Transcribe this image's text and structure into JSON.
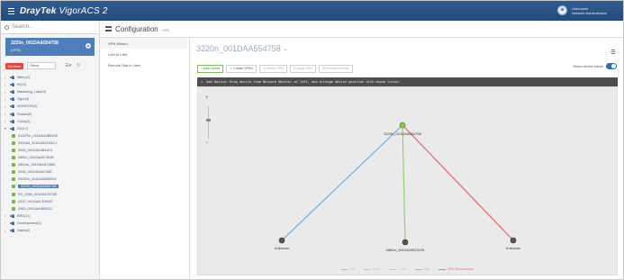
{
  "app": {
    "brand_name": "DrayTek",
    "product_name": "VigorACS 2",
    "user_line1": "Username",
    "user_line2": "Network Administrator"
  },
  "search": {
    "placeholder": "Search..."
  },
  "device_card": {
    "name": "3220n_001DAA554758",
    "sub": "(VPN)"
  },
  "tree_toolbar": {
    "filter_label": "Devices",
    "show_label": "Show",
    "icon_a": "☰▾",
    "icon_b": "↻"
  },
  "tree": [
    {
      "type": "group",
      "label": "Metro(1)"
    },
    {
      "type": "group",
      "label": "IK(12)"
    },
    {
      "type": "group",
      "label": "Marketing_Lab(42)"
    },
    {
      "type": "group",
      "label": "Vigor(3)"
    },
    {
      "type": "group",
      "label": "MONITOR(3)"
    },
    {
      "type": "group",
      "label": "Russia(0)"
    },
    {
      "type": "group",
      "label": "China(3)"
    },
    {
      "type": "group",
      "label": "RD(17)",
      "expanded": true
    },
    {
      "type": "device",
      "label": "3132Pro_001DAA4BB035"
    },
    {
      "type": "device",
      "label": "2920Ad_001DAA01D3C1"
    },
    {
      "type": "device",
      "label": "2925_001DAA4BA474"
    },
    {
      "type": "device",
      "label": "2860n_001DAA573538"
    },
    {
      "type": "device",
      "label": "2862ac_001DAA671685"
    },
    {
      "type": "device",
      "label": "2926_001DAA807385"
    },
    {
      "type": "device",
      "label": "2925Vn_001DAA6B5009"
    },
    {
      "type": "device",
      "label": "3220n_001DAA554758",
      "selected": true
    },
    {
      "type": "device",
      "label": "RX_2960_001DAA7573B"
    },
    {
      "type": "device",
      "label": "2920_001DAA7D5003"
    },
    {
      "type": "device",
      "label": "2960_001DAA4B80C1"
    },
    {
      "type": "group",
      "label": "BRD(11)"
    },
    {
      "type": "group",
      "label": "Development(1)"
    },
    {
      "type": "group",
      "label": "Sales(3)"
    }
  ],
  "page": {
    "section_title": "Configuration",
    "section_sub": "- VPN"
  },
  "subnav": [
    "VPN Wizard",
    "LAN to LAN",
    "Remote Dial-in User"
  ],
  "main": {
    "title": "3220n_001DAA554758",
    "title_icon": "↪"
  },
  "toolbar": {
    "buttons": [
      "+ Add Device",
      "✓ Create VPN's",
      "⊘ Delete VPN",
      "↻ Apply VPN",
      "⚙ Remove Device"
    ]
  },
  "device_name_toggle": {
    "label": "Show device name",
    "on": true
  },
  "hint": {
    "text": "Add Device: Drag device from Network Monitor at left, and arrange device position with mouse cursor."
  },
  "zoom": {
    "plus": "+",
    "minus": "−"
  },
  "topology": {
    "hub": {
      "label": "3220n_001DAA554758"
    },
    "nodes": [
      {
        "label": "Unknown",
        "link_color": "#6baee0"
      },
      {
        "label": "2860n_001DAA5D3106",
        "link_color": "#8fd26e"
      },
      {
        "label": "Unknown",
        "link_color": "#ec6071"
      }
    ]
  },
  "legend": [
    {
      "label": "OK",
      "color": "#8fc3ea"
    },
    {
      "label": "Error",
      "color": "#9fd67b"
    },
    {
      "label": "Local",
      "color": "#c8d26e"
    },
    {
      "label": "Key",
      "color": "#a7c870"
    },
    {
      "label": "VPN disconnected",
      "color": "#ef7280"
    }
  ],
  "colors": {
    "header": "#2f5d92",
    "accent": "#4f7fba",
    "toggle_on": "#2f6fb8",
    "add_button": "#7bbf5b",
    "tree_red_button": "#e0483f"
  }
}
